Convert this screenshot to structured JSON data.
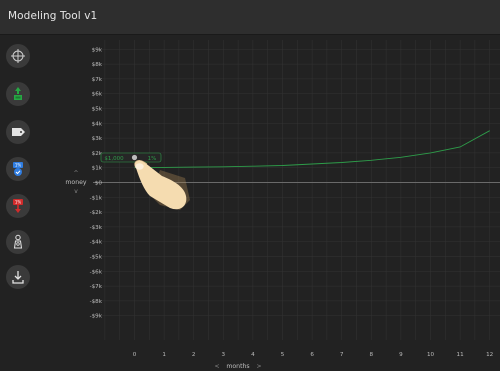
{
  "app": {
    "title": "Modeling Tool v1"
  },
  "toolbar": {
    "items": [
      {
        "icon": "crosshair-icon",
        "label": ""
      },
      {
        "icon": "add-money-icon",
        "label": ""
      },
      {
        "icon": "tag-icon",
        "label": ""
      },
      {
        "icon": "percent-up-icon",
        "label": ""
      },
      {
        "icon": "percent-down-icon",
        "label": ""
      },
      {
        "icon": "person-icon",
        "label": ""
      },
      {
        "icon": "download-icon",
        "label": ""
      }
    ]
  },
  "axes": {
    "y_label": "money",
    "x_label": "months",
    "y_up_arrow": "^",
    "y_down_arrow": "v",
    "x_left_arrow": "<",
    "x_right_arrow": ">"
  },
  "chart_data": {
    "type": "line",
    "xlabel": "months",
    "ylabel": "money",
    "x_ticks": [
      "0",
      "1",
      "2",
      "3",
      "4",
      "5",
      "6",
      "7",
      "8",
      "9",
      "10",
      "11",
      "12"
    ],
    "y_ticks": [
      "$9k",
      "$8k",
      "$7k",
      "$6k",
      "$5k",
      "$4k",
      "$3k",
      "$2k",
      "$1k",
      "$0",
      "-$1k",
      "-$2k",
      "-$3k",
      "-$4k",
      "-$5k",
      "-$6k",
      "-$7k",
      "-$8k",
      "-$9k"
    ],
    "xlim": [
      0,
      12
    ],
    "ylim": [
      -9000,
      9000
    ],
    "grid": true,
    "series": [
      {
        "color": "#2e9d4a",
        "x": [
          0,
          1,
          2,
          3,
          4,
          5,
          6,
          7,
          8,
          9,
          10,
          11,
          12
        ],
        "y": [
          1000,
          1020,
          1040,
          1060,
          1100,
          1150,
          1250,
          1350,
          1500,
          1700,
          2000,
          2400,
          3500
        ]
      }
    ],
    "annotation": {
      "start_value": "$1,000",
      "rate": "1%",
      "x": 0,
      "y": 1000
    }
  },
  "colors": {
    "background": "#222222",
    "titlebar": "#2e2e2e",
    "grid": "#343434",
    "zero_line": "#6a6a6a",
    "line": "#2e9d4a",
    "accent_green": "#27a844",
    "accent_red": "#d12b2b",
    "accent_blue": "#2f7de1"
  }
}
